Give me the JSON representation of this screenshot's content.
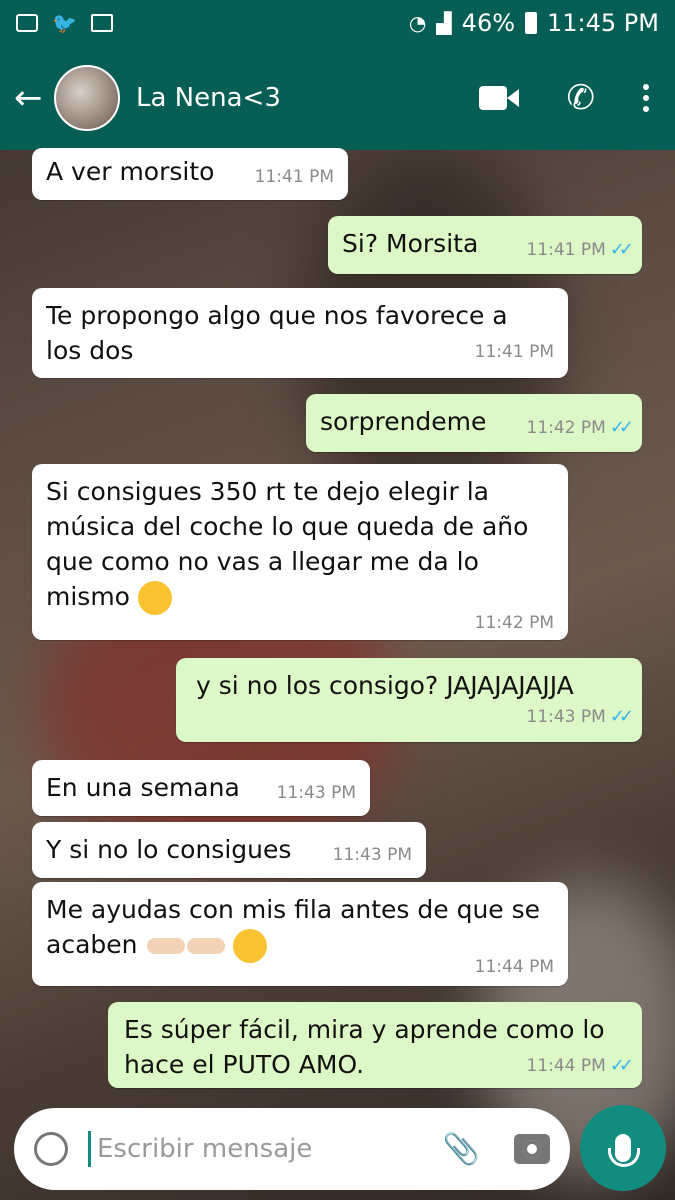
{
  "status_bar": {
    "battery": "46%",
    "time": "11:45 PM",
    "left_icons": [
      "screen-icon",
      "twitter-icon",
      "mail-icon"
    ],
    "right_icons": [
      "wifi-icon",
      "signal-icon",
      "battery-icon"
    ]
  },
  "header": {
    "back_icon": "←",
    "contact_name": "La Nena<3",
    "icons": [
      "video-call-icon",
      "voice-call-icon",
      "more-menu-icon"
    ]
  },
  "messages": [
    {
      "dir": "in",
      "text": "A ver morsito",
      "time": "11:41 PM"
    },
    {
      "dir": "out",
      "text": "Si? Morsita",
      "time": "11:41 PM",
      "ticks": "✓✓"
    },
    {
      "dir": "in",
      "text": "Te propongo algo que nos favorece a los dos",
      "time": "11:41 PM"
    },
    {
      "dir": "out",
      "text": "sorprendeme",
      "time": "11:42 PM",
      "ticks": "✓✓"
    },
    {
      "dir": "in",
      "text": "Si consigues 350 rt te dejo elegir la música del coche lo que queda de año que como no vas a llegar me da lo mismo",
      "time": "11:42 PM",
      "emoji": "kiss-emoji"
    },
    {
      "dir": "out",
      "text": "y si no los consigo? JAJAJAJAJJA",
      "time": "11:43 PM",
      "ticks": "✓✓"
    },
    {
      "dir": "in",
      "text": "En una semana",
      "time": "11:43 PM"
    },
    {
      "dir": "in",
      "text": "Y si no lo consigues",
      "time": "11:43 PM"
    },
    {
      "dir": "in",
      "text": "Me ayudas con mis fila antes de que se acaben",
      "time": "11:44 PM",
      "emoji": "pointing-halo-emoji"
    },
    {
      "dir": "out",
      "text": "Es súper fácil, mira y aprende como lo hace el PUTO AMO.",
      "time": "11:44 PM",
      "ticks": "✓✓"
    }
  ],
  "composer": {
    "placeholder": "Escribir mensaje",
    "icons": [
      "emoji-icon",
      "attach-icon",
      "camera-icon",
      "mic-icon"
    ]
  },
  "colors": {
    "header": "#075e54",
    "outgoing_bubble": "#dcf8c6",
    "incoming_bubble": "#ffffff",
    "read_ticks": "#34b7f1",
    "mic_button": "#128c7e"
  }
}
